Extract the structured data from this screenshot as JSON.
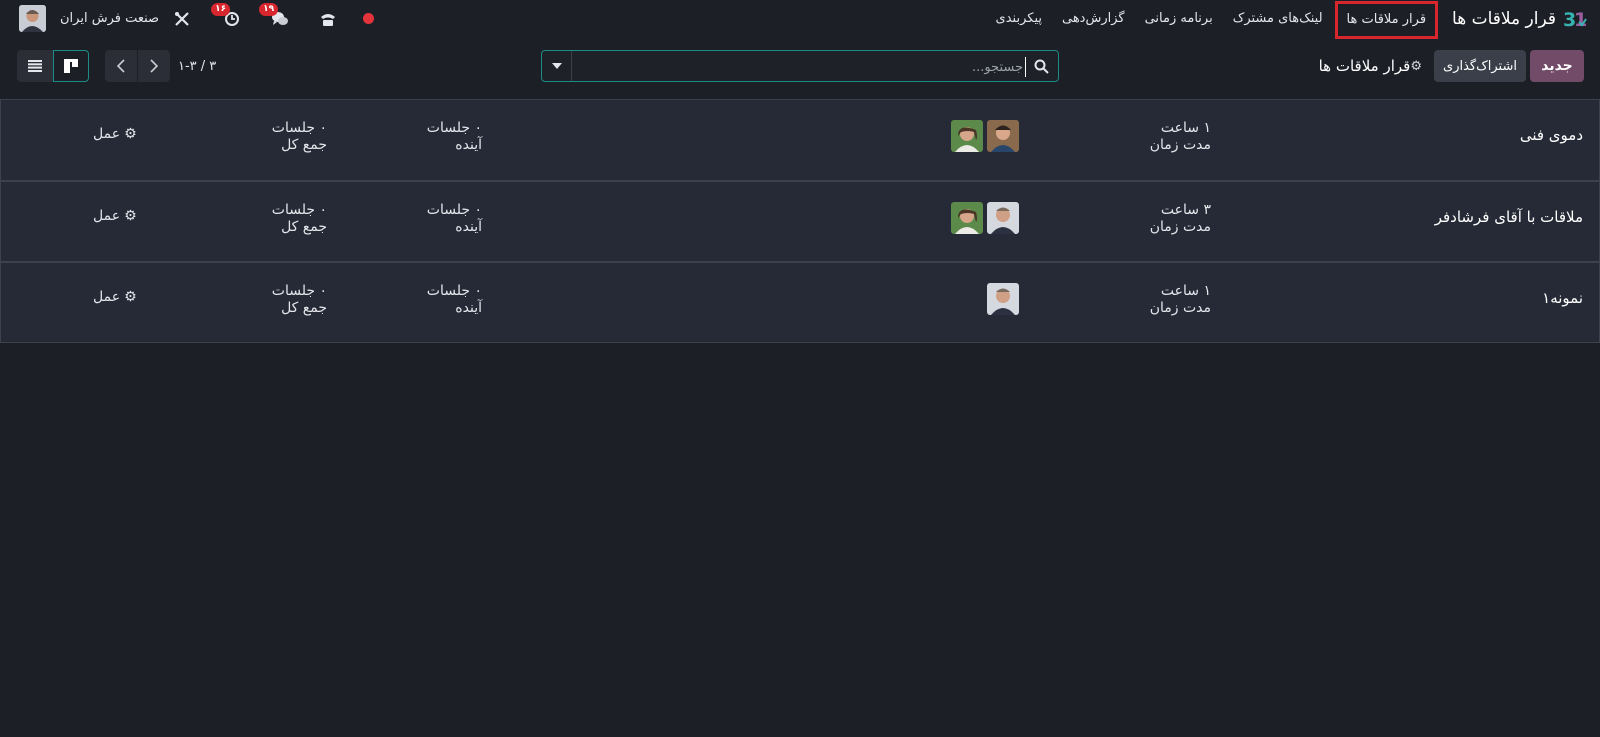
{
  "navbar": {
    "app_title": "قرار ملاقات ها",
    "menu": [
      "قرار ملاقات ها",
      "لینک‌های مشترک",
      "برنامه زمانی",
      "گزارش‌دهی",
      "پیکربندی"
    ],
    "company": "صنعت فرش ایران",
    "activity_badge": "۱۶",
    "chat_badge": "۱۹"
  },
  "control": {
    "new_label": "جدید",
    "share_label": "اشتراک‌گذاری",
    "breadcrumb": "قرار ملاقات ها",
    "search_placeholder": "جستجو...",
    "pager": "۱-۳ / ۳"
  },
  "records": [
    {
      "title": "دموی فنی",
      "duration_value": "۱ ساعت",
      "duration_label": "مدت زمان",
      "upcoming_value": "۰ جلسات",
      "upcoming_label": "آینده",
      "total_value": "۰ جلسات",
      "total_label": "جمع کل",
      "action": "عمل"
    },
    {
      "title": "ملاقات با آقای فرشادفر",
      "duration_value": "۳ ساعت",
      "duration_label": "مدت زمان",
      "upcoming_value": "۰ جلسات",
      "upcoming_label": "آینده",
      "total_value": "۰ جلسات",
      "total_label": "جمع کل",
      "action": "عمل"
    },
    {
      "title": "نمونه۱",
      "duration_value": "۱ ساعت",
      "duration_label": "مدت زمان",
      "upcoming_value": "۰ جلسات",
      "upcoming_label": "آینده",
      "total_value": "۰ جلسات",
      "total_label": "جمع کل",
      "action": "عمل"
    }
  ],
  "colors": {
    "primary": "#714b67",
    "accent": "#1d8c86",
    "badge": "#d7262d",
    "background": "#1d1f26",
    "card": "#262a36"
  },
  "icons": [
    "appointment-app-icon",
    "tools-icon",
    "activity-clock-icon",
    "chat-icon",
    "phone-icon",
    "record-dot-icon",
    "gear-icon",
    "search-icon",
    "caret-down-icon",
    "chevron-left-icon",
    "chevron-right-icon",
    "list-view-icon",
    "kanban-view-icon"
  ]
}
